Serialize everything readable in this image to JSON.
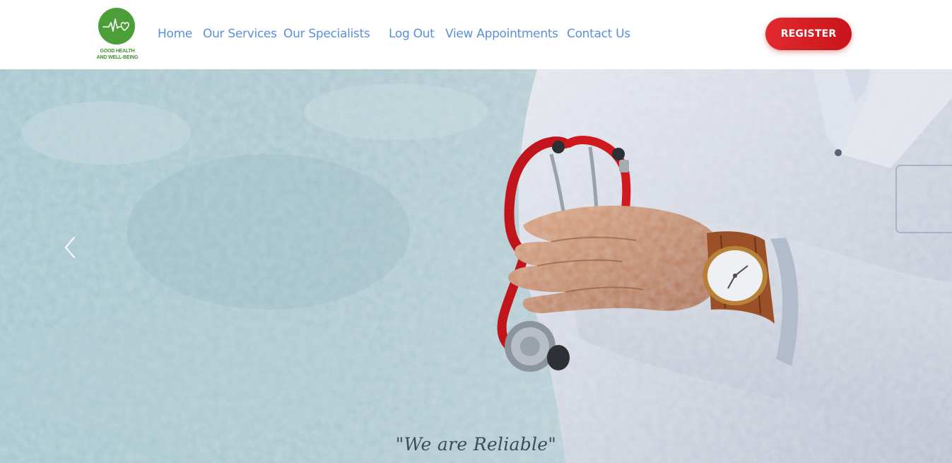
{
  "brand": {
    "logo_line1": "GOOD HEALTH",
    "logo_line2": "AND WELL-BEING",
    "logo_color": "#4c9f38",
    "logo_icon": "heartbeat-heart-icon"
  },
  "nav": {
    "items": [
      {
        "label": "Home"
      },
      {
        "label": "Our Services"
      },
      {
        "label": "Our Specialists"
      },
      {
        "label": "Log Out"
      },
      {
        "label": "View Appointments"
      },
      {
        "label": "Contact Us"
      }
    ],
    "link_color": "#5b8fde"
  },
  "header": {
    "register_label": "REGISTER",
    "register_color": "#d81e24"
  },
  "hero": {
    "caption": "\"We are Reliable\"",
    "prev_icon": "chevron-left-icon",
    "image_subject": "doctor-with-stethoscope-image"
  }
}
